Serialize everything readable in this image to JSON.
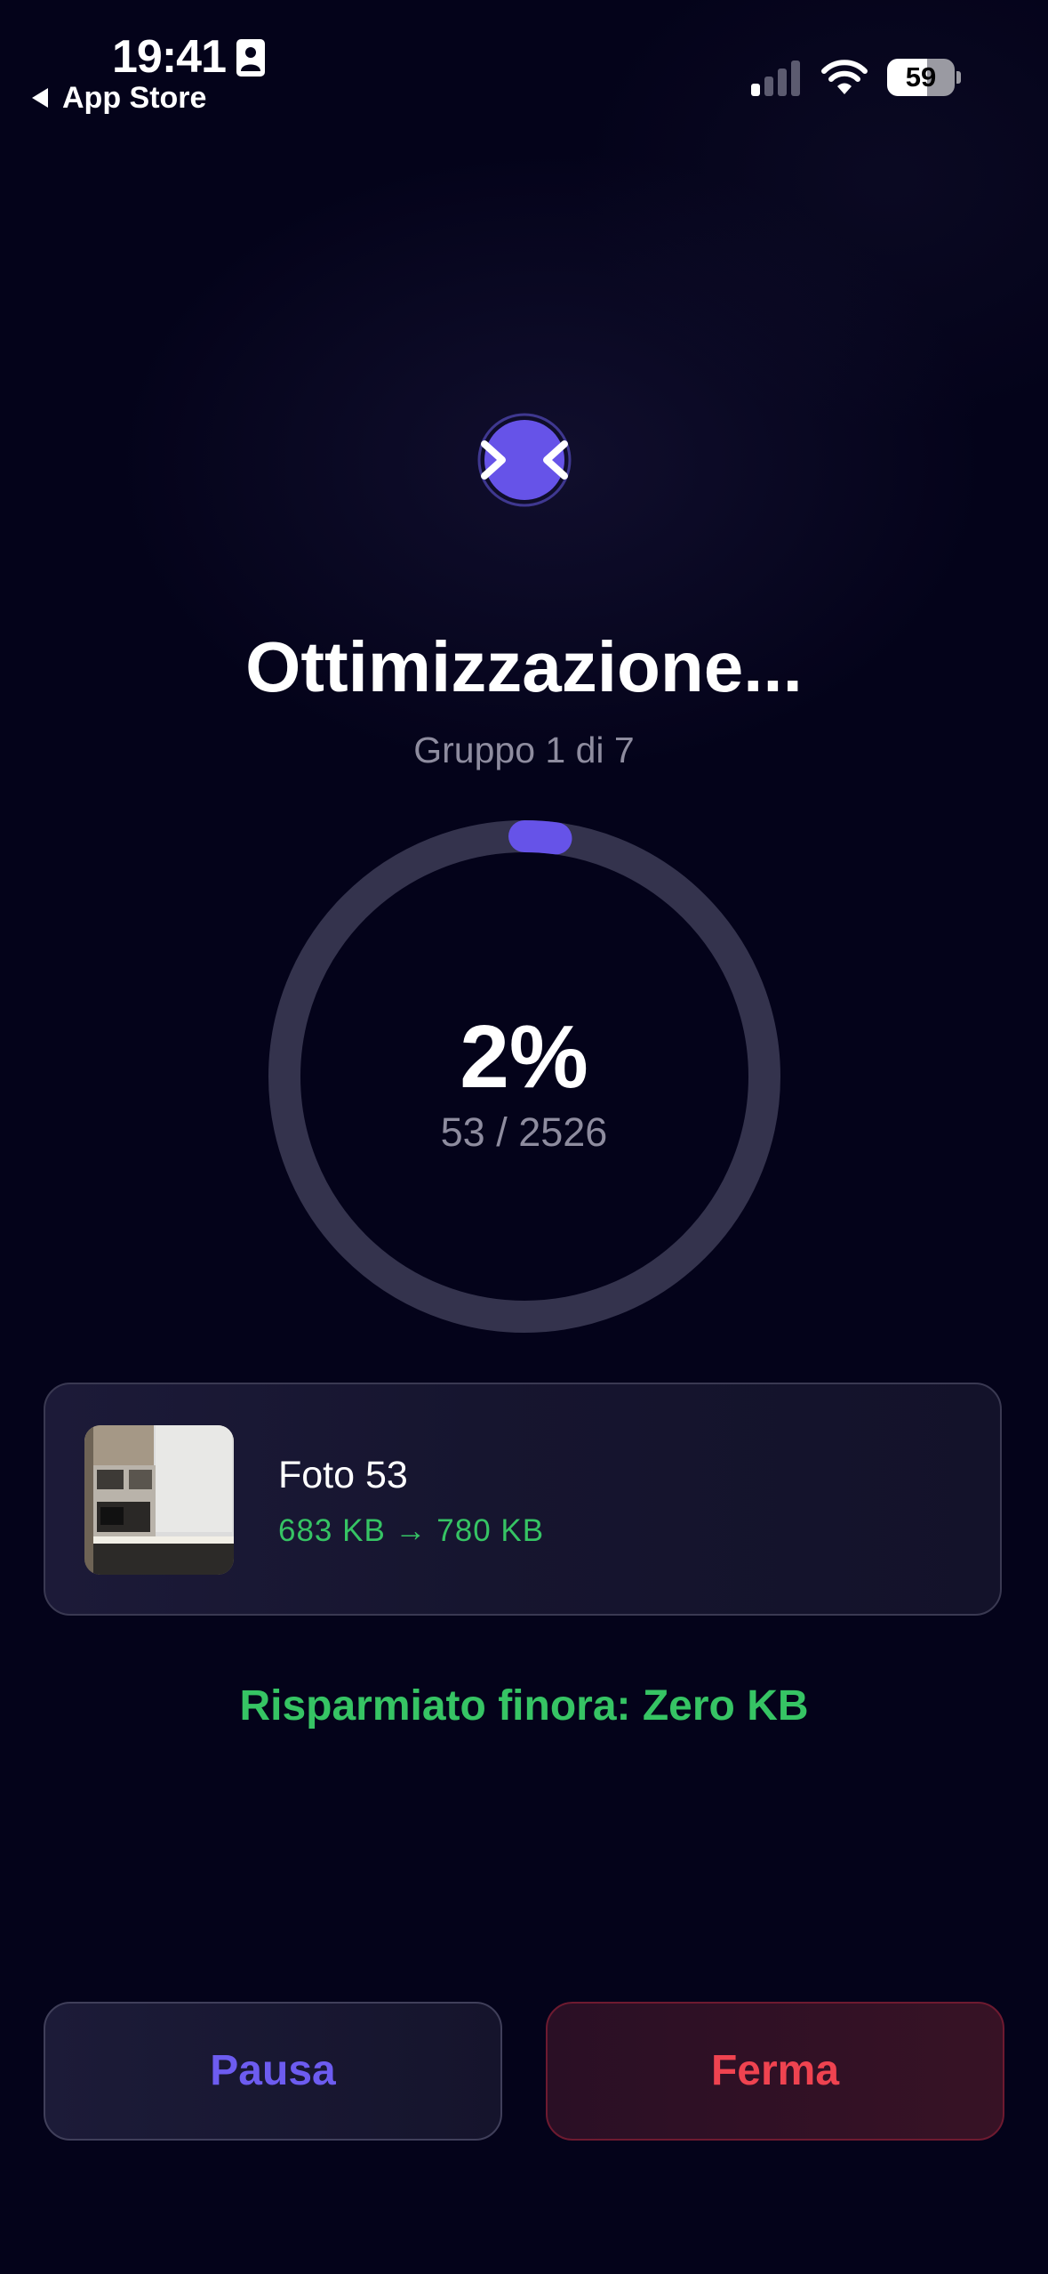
{
  "status_bar": {
    "time": "19:41",
    "back_label": "App Store",
    "battery_level": "59",
    "battery_fraction": 0.59
  },
  "screen": {
    "title": "Ottimizzazione...",
    "subtitle": "Gruppo 1 di 7",
    "progress": {
      "percent_label": "2%",
      "count_label": "53 / 2526",
      "done": 53,
      "total": 2526
    },
    "current_photo": {
      "name": "Foto 53",
      "size_change": "683 KB → 780 KB"
    },
    "saved_label": "Risparmiato finora: Zero KB",
    "buttons": {
      "pause": "Pausa",
      "stop": "Ferma"
    }
  },
  "colors": {
    "background": "#04031a",
    "accent": "#6d5cf0",
    "success": "#36c464",
    "danger": "#ef4350",
    "ring_track": "#34334d"
  },
  "icons": [
    "person-focus-icon",
    "back-arrow-icon",
    "cellular-signal-icon",
    "wifi-icon",
    "battery-icon",
    "compress-arrows-icon"
  ]
}
